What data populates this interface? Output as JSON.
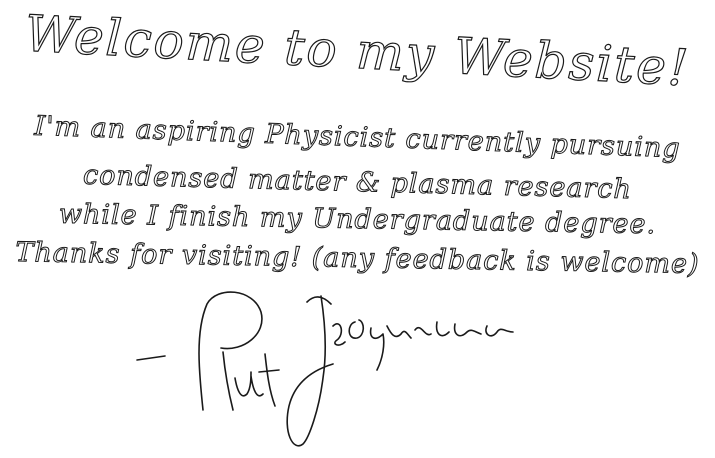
{
  "headline": "Welcome to my Website!",
  "message": {
    "line1": "I'm an aspiring Physicist currently pursuing",
    "line2": "condensed matter & plasma research",
    "line3": "while I finish my Undergraduate degree.",
    "line4": "Thanks for visiting! (any feedback is welcome)"
  },
  "signature": {
    "name": "Pat Jackson"
  },
  "colors": {
    "ink": "#1a1a1a",
    "paper": "#ffffff"
  }
}
